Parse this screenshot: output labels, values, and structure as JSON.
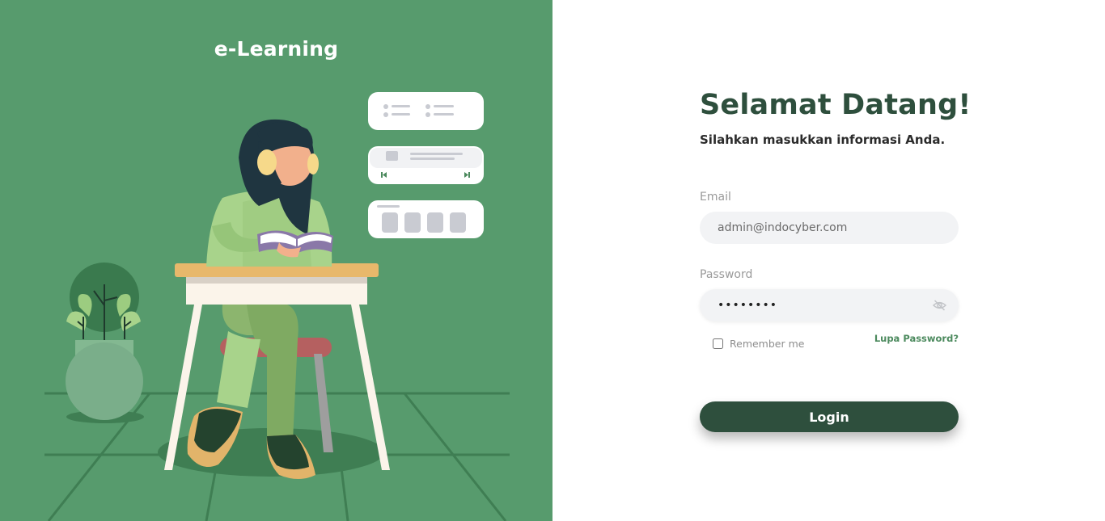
{
  "brand": {
    "name": "e-Learning"
  },
  "login": {
    "title": "Selamat Datang!",
    "subtitle": "Silahkan masukkan informasi Anda.",
    "email_label": "Email",
    "email_value": "admin@indocyber.com",
    "password_label": "Password",
    "password_value": "••••••••",
    "remember_label": "Remember me",
    "forgot_label": "Lupa Password?",
    "login_label": "Login"
  },
  "icons": {
    "password_toggle": "eye-slash-icon"
  },
  "colors": {
    "panel_green": "#579b6d",
    "primary_dark": "#2e4f3d",
    "link_green": "#4c8a5e",
    "input_bg": "#f2f3f5"
  }
}
